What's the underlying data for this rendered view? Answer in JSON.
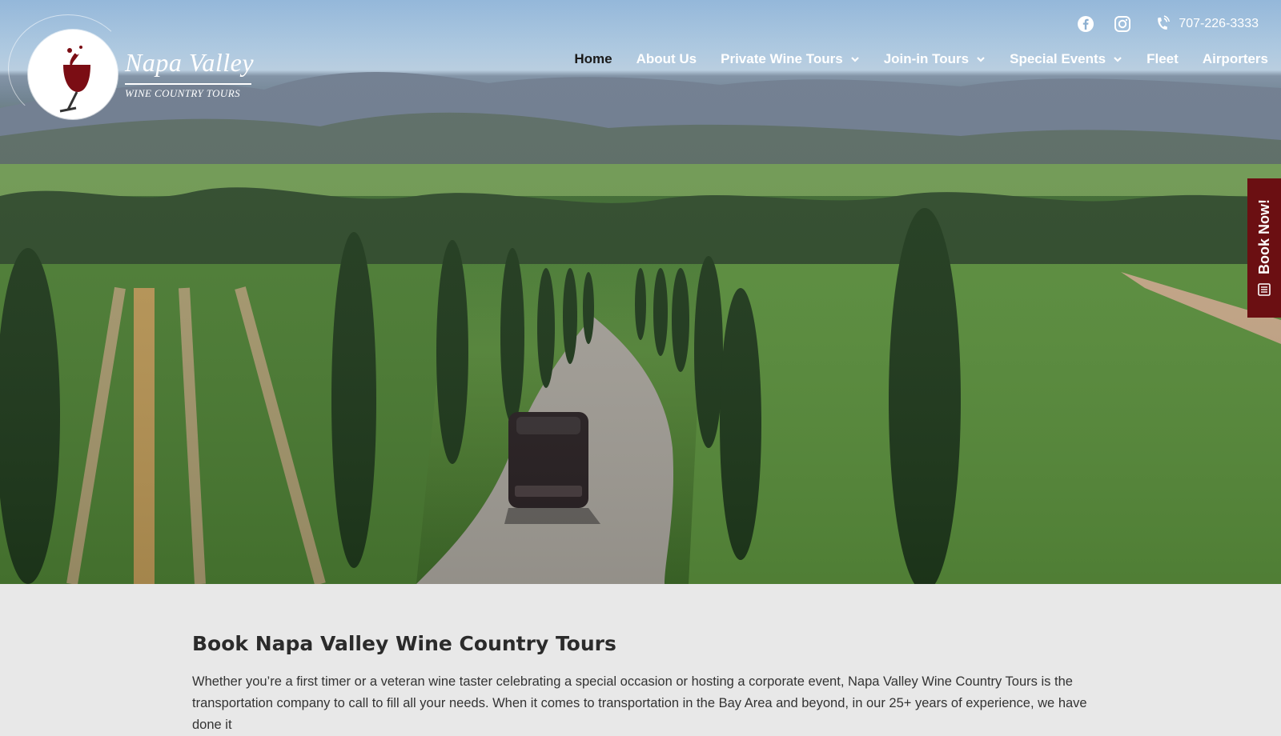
{
  "brand": {
    "title": "Napa Valley",
    "subtitle": "WINE COUNTRY TOURS"
  },
  "topbar": {
    "phone": "707-226-3333",
    "icons": [
      "facebook-icon",
      "instagram-icon",
      "phone-volume-icon"
    ]
  },
  "nav": {
    "items": [
      {
        "label": "Home",
        "active": true,
        "dropdown": false
      },
      {
        "label": "About Us",
        "active": false,
        "dropdown": false
      },
      {
        "label": "Private Wine Tours",
        "active": false,
        "dropdown": true
      },
      {
        "label": "Join-in Tours",
        "active": false,
        "dropdown": true
      },
      {
        "label": "Special Events",
        "active": false,
        "dropdown": true
      },
      {
        "label": "Fleet",
        "active": false,
        "dropdown": false
      },
      {
        "label": "Airporters",
        "active": false,
        "dropdown": false
      }
    ]
  },
  "side_tab": {
    "label": "Book Now!",
    "icon": "calendar-list-icon"
  },
  "content": {
    "heading": "Book Napa Valley Wine Country Tours",
    "paragraph": "Whether you’re a first timer or a veteran wine taster celebrating a special occasion or hosting a corporate event, Napa Valley Wine Country Tours is the transportation company to call to fill all your needs. When it comes to transportation in the Bay Area and beyond, in our 25+ years of experience, we have done it"
  },
  "colors": {
    "accent": "#6b0f12",
    "nav_text": "#ffffff",
    "nav_active": "#1a1a1a",
    "page_bg": "#e8e8e8"
  }
}
